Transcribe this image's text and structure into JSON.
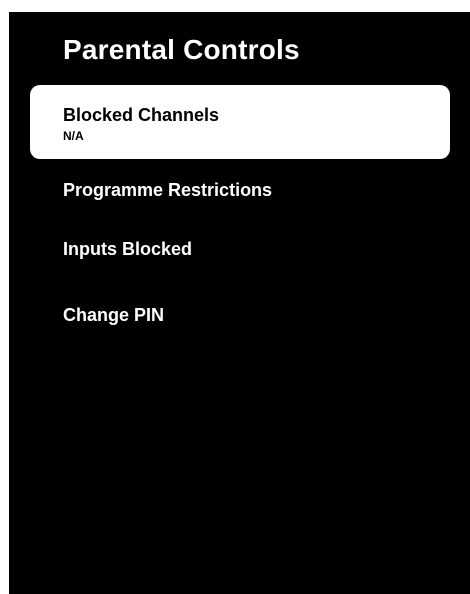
{
  "header": {
    "title": "Parental Controls"
  },
  "menu": {
    "items": [
      {
        "label": "Blocked Channels",
        "value": "N/A",
        "selected": true
      },
      {
        "label": "Programme Restrictions"
      },
      {
        "label": "Inputs Blocked"
      },
      {
        "label": "Change PIN"
      }
    ]
  },
  "colors": {
    "background": "#000000",
    "selected_background": "#ffffff",
    "text": "#ffffff",
    "selected_text": "#000000"
  }
}
